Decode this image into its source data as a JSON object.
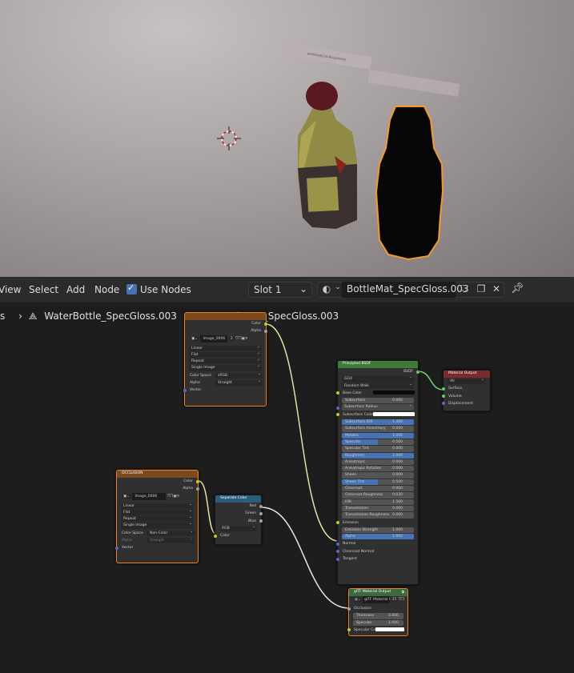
{
  "viewport": {
    "label_text": "perMetalLCG-Roughness"
  },
  "header": {
    "view": "View",
    "select": "Select",
    "add": "Add",
    "node": "Node",
    "use_nodes": "Use Nodes",
    "slot": "Slot 1",
    "material": "BottleMat_SpecGloss.003"
  },
  "breadcrumb": {
    "scene": "s",
    "object": "WaterBottle_SpecGloss.003",
    "material": "BottleMat_SpecGloss.003"
  },
  "image_node": {
    "out_color": "Color",
    "out_alpha": "Alpha",
    "image": "Image_0006",
    "users": "2",
    "interp": "Linear",
    "proj": "Flat",
    "ext": "Repeat",
    "source": "Single Image",
    "colorspace_label": "Color Space",
    "colorspace": "sRGB",
    "alpha_label": "Alpha",
    "alpha": "Straight",
    "vector": "Vector"
  },
  "occlusion_node": {
    "title": "OCCLUSION",
    "out_color": "Color",
    "out_alpha": "Alpha",
    "image": "Image_0006",
    "interp": "Linear",
    "proj": "Flat",
    "ext": "Repeat",
    "source": "Single Image",
    "colorspace_label": "Color Space",
    "colorspace": "Non-Color",
    "alpha_label": "Alpha",
    "alpha": "Straight",
    "vector": "Vector"
  },
  "separate_node": {
    "title": "Separate Color",
    "out_red": "Red",
    "out_green": "Green",
    "out_blue": "Blue",
    "mode": "RGB",
    "in_color": "Color"
  },
  "bsdf_node": {
    "title": "Principled BSDF",
    "out": "BSDF",
    "distribution": "GGX",
    "subsurface_method": "Random Walk",
    "rows": [
      {
        "label": "Base Color",
        "kind": "color"
      },
      {
        "label": "Subsurface",
        "value": "0.000",
        "fill": 0
      },
      {
        "label": "Subsurface Radius",
        "kind": "dropdown"
      },
      {
        "label": "Subsurface Color",
        "kind": "swatch"
      },
      {
        "label": "Subsurface IOR",
        "value": "1.400",
        "fill": 1
      },
      {
        "label": "Subsurface Anisotropy",
        "value": "0.000",
        "fill": 0
      },
      {
        "label": "Metallic",
        "value": "1.000",
        "fill": 1
      },
      {
        "label": "Specular",
        "value": "0.500",
        "fill": 0.5
      },
      {
        "label": "Specular Tint",
        "value": "0.000",
        "fill": 0
      },
      {
        "label": "Roughness",
        "value": "1.000",
        "fill": 1
      },
      {
        "label": "Anisotropic",
        "value": "0.000",
        "fill": 0
      },
      {
        "label": "Anisotropic Rotation",
        "value": "0.000",
        "fill": 0
      },
      {
        "label": "Sheen",
        "value": "0.000",
        "fill": 0
      },
      {
        "label": "Sheen Tint",
        "value": "0.500",
        "fill": 0.5
      },
      {
        "label": "Clearcoat",
        "value": "0.000",
        "fill": 0
      },
      {
        "label": "Clearcoat Roughness",
        "value": "0.030",
        "fill": 0
      },
      {
        "label": "IOR",
        "value": "1.500",
        "fill": 0
      },
      {
        "label": "Transmission",
        "value": "0.000",
        "fill": 0
      },
      {
        "label": "Transmission Roughness",
        "value": "0.000",
        "fill": 0
      },
      {
        "label": "Emission",
        "kind": "socket"
      },
      {
        "label": "Emission Strength",
        "value": "1.000",
        "fill": 0
      },
      {
        "label": "Alpha",
        "value": "1.000",
        "fill": 1
      },
      {
        "label": "Normal",
        "kind": "socket"
      },
      {
        "label": "Clearcoat Normal",
        "kind": "socket"
      },
      {
        "label": "Tangent",
        "kind": "socket"
      }
    ]
  },
  "output_node": {
    "title": "Material Output",
    "target": "All",
    "surface": "Surface",
    "volume": "Volume",
    "displacement": "Displacement"
  },
  "gltf_node": {
    "title": "glTF Material Output",
    "group": "glTF Material Ou...",
    "group_users": "35",
    "occlusion": "Occlusion",
    "thickness_label": "Thickness",
    "thickness": "0.000",
    "specular_label": "Specular",
    "specular": "1.000",
    "specular_color": "Specular Color"
  }
}
